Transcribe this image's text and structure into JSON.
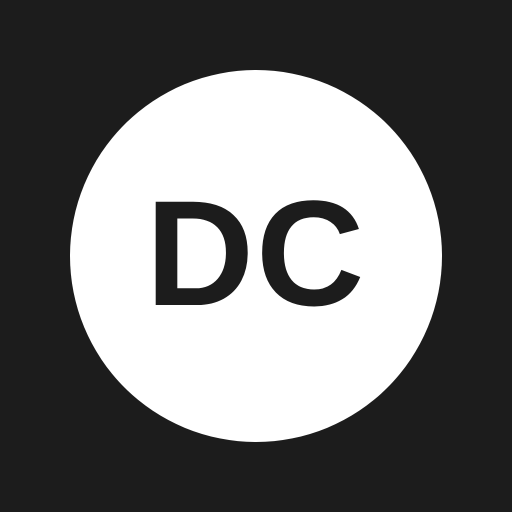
{
  "avatar": {
    "initials": "DC",
    "background_color": "#1c1c1c",
    "circle_color": "#ffffff",
    "text_color": "#1c1c1c"
  }
}
